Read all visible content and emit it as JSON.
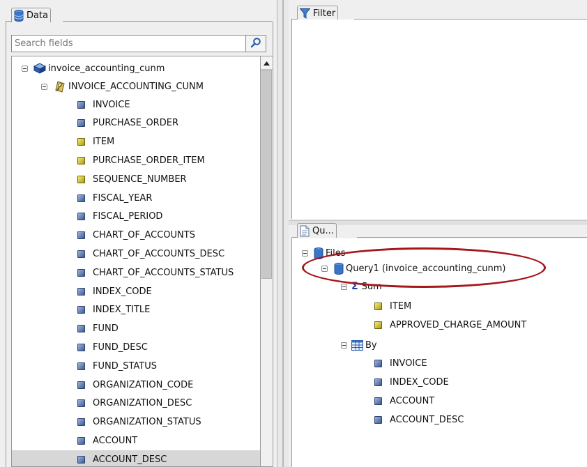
{
  "data_panel": {
    "title": "Data",
    "search": {
      "placeholder": "Search fields",
      "value": ""
    },
    "tree": {
      "root": "invoice_accounting_cunm",
      "table": "INVOICE_ACCOUNTING_CUNM",
      "fields": [
        {
          "name": "INVOICE",
          "type": "dimension"
        },
        {
          "name": "PURCHASE_ORDER",
          "type": "dimension"
        },
        {
          "name": "ITEM",
          "type": "measure"
        },
        {
          "name": "PURCHASE_ORDER_ITEM",
          "type": "measure"
        },
        {
          "name": "SEQUENCE_NUMBER",
          "type": "measure"
        },
        {
          "name": "FISCAL_YEAR",
          "type": "dimension"
        },
        {
          "name": "FISCAL_PERIOD",
          "type": "dimension"
        },
        {
          "name": "CHART_OF_ACCOUNTS",
          "type": "dimension"
        },
        {
          "name": "CHART_OF_ACCOUNTS_DESC",
          "type": "dimension"
        },
        {
          "name": "CHART_OF_ACCOUNTS_STATUS",
          "type": "dimension"
        },
        {
          "name": "INDEX_CODE",
          "type": "dimension"
        },
        {
          "name": "INDEX_TITLE",
          "type": "dimension"
        },
        {
          "name": "FUND",
          "type": "dimension"
        },
        {
          "name": "FUND_DESC",
          "type": "dimension"
        },
        {
          "name": "FUND_STATUS",
          "type": "dimension"
        },
        {
          "name": "ORGANIZATION_CODE",
          "type": "dimension"
        },
        {
          "name": "ORGANIZATION_DESC",
          "type": "dimension"
        },
        {
          "name": "ORGANIZATION_STATUS",
          "type": "dimension"
        },
        {
          "name": "ACCOUNT",
          "type": "dimension"
        },
        {
          "name": "ACCOUNT_DESC",
          "type": "dimension",
          "selected": true
        }
      ]
    }
  },
  "filter_panel": {
    "title": "Filter"
  },
  "query_panel": {
    "title": "Qu...",
    "files_label": "Files",
    "query_label": "Query1 (invoice_accounting_cunm)",
    "sum_label": "Sum",
    "sum_fields": [
      "ITEM",
      "APPROVED_CHARGE_AMOUNT"
    ],
    "by_label": "By",
    "by_fields": [
      "INVOICE",
      "INDEX_CODE",
      "ACCOUNT",
      "ACCOUNT_DESC"
    ]
  },
  "colors": {
    "highlight_oval": "#a5171b",
    "dimension_icon": "#3c5a92",
    "measure_icon": "#c8bb1c",
    "selection": "#d7d7d7"
  }
}
